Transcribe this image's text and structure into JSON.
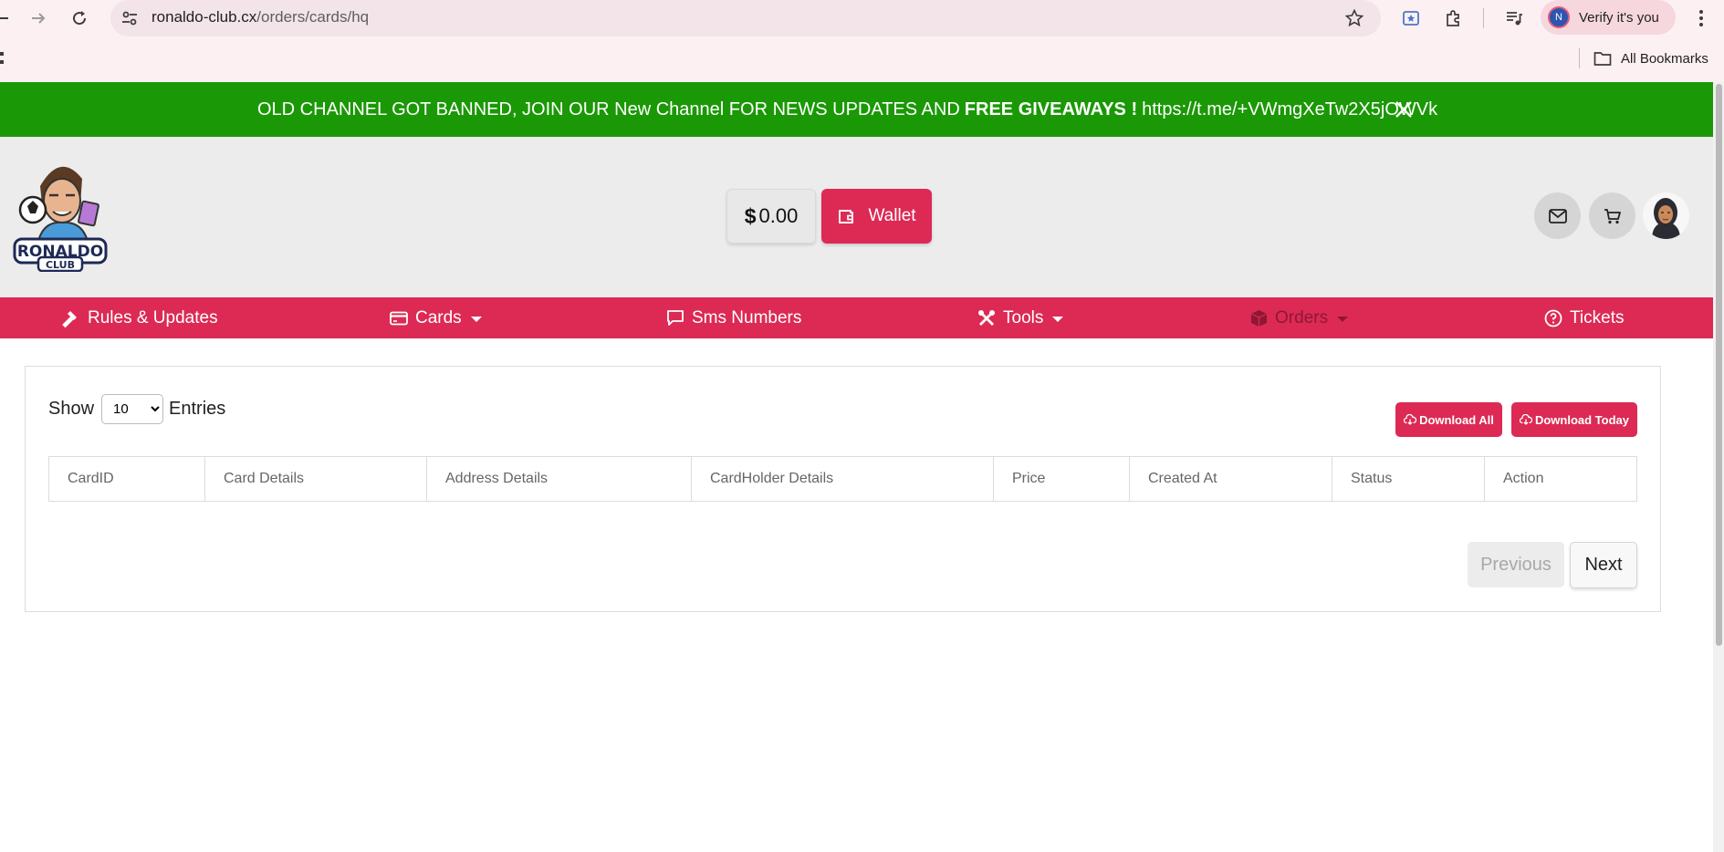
{
  "browser": {
    "url_host": "ronaldo-club.cx",
    "url_path": "/orders/cards/hq",
    "profile_initial": "N",
    "profile_label": "Verify it's you",
    "bookmarks_label": "All Bookmarks"
  },
  "announcement": {
    "text_start": "OLD CHANNEL GOT BANNED, JOIN OUR New Channel FOR NEWS UPDATES AND",
    "text_bold": "FREE GIVEAWAYS !",
    "link": "https://t.me/+VWmgXeTw2X5jOWVk",
    "bg_color": "#1b9806"
  },
  "header": {
    "logo_line1": "RONALDO",
    "logo_line2": "CLUB",
    "currency_symbol": "$",
    "balance": "0.00",
    "wallet_label": "Wallet"
  },
  "nav": {
    "items": [
      {
        "label": "Rules & Updates",
        "icon": "hammer-icon"
      },
      {
        "label": "Cards",
        "icon": "credit-card-icon"
      },
      {
        "label": "Sms Numbers",
        "icon": "chat-icon"
      },
      {
        "label": "Tools",
        "icon": "tools-icon"
      },
      {
        "label": "Orders",
        "icon": "box-icon"
      },
      {
        "label": "Tickets",
        "icon": "question-circle-icon"
      }
    ],
    "bg_color": "#dc2a54"
  },
  "table": {
    "show_label": "Show",
    "entries_label": "Entries",
    "page_size": "10",
    "download_all": "Download All",
    "download_today": "Download Today",
    "columns": [
      "CardID",
      "Card Details",
      "Address Details",
      "CardHolder Details",
      "Price",
      "Created At",
      "Status",
      "Action"
    ]
  },
  "pagination": {
    "previous": "Previous",
    "next": "Next"
  }
}
